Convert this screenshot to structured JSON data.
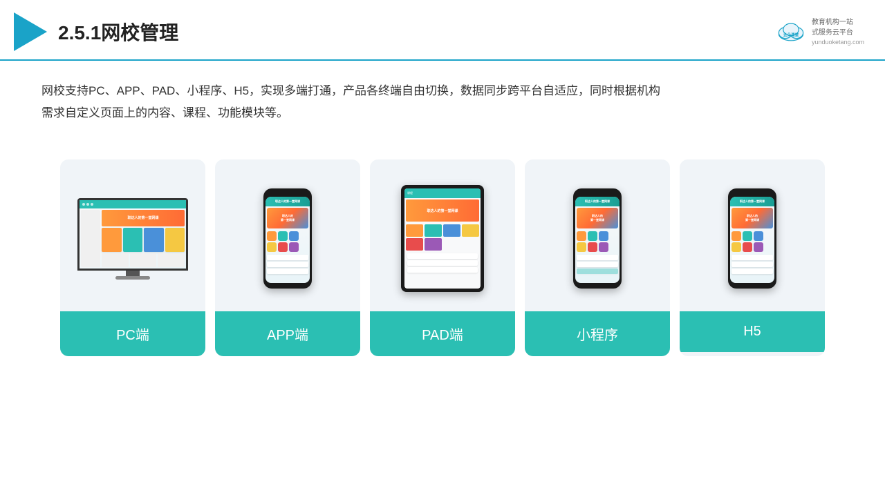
{
  "header": {
    "title": "2.5.1网校管理",
    "brand_name": "云朵课堂",
    "brand_url": "yunduoketang.com",
    "brand_tagline": "教育机构一站\n式服务云平台"
  },
  "description": {
    "text_line1": "网校支持PC、APP、PAD、小程序、H5，实现多端打通，产品各终端自由切换，数据同步跨平台自适应，同时根据机构",
    "text_line2": "需求自定义页面上的内容、课程、功能模块等。"
  },
  "cards": [
    {
      "id": "pc",
      "label": "PC端"
    },
    {
      "id": "app",
      "label": "APP端"
    },
    {
      "id": "pad",
      "label": "PAD端"
    },
    {
      "id": "miniprogram",
      "label": "小程序"
    },
    {
      "id": "h5",
      "label": "H5"
    }
  ],
  "colors": {
    "accent": "#2bbfb3",
    "dark": "#1a1a1a",
    "bg_card": "#f0f4f8",
    "header_line": "#1aa3c8"
  }
}
